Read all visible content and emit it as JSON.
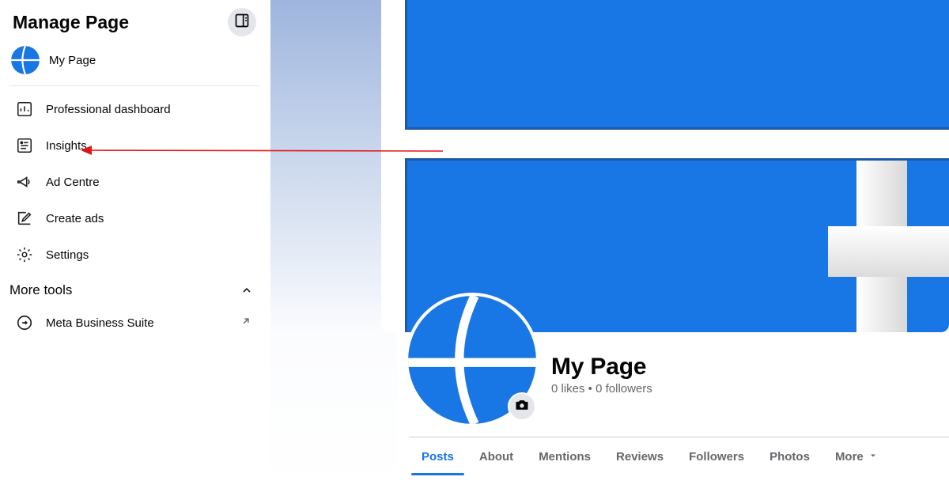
{
  "sidebar": {
    "title": "Manage Page",
    "page_name": "My Page",
    "items": [
      {
        "label": "Professional dashboard"
      },
      {
        "label": "Insights"
      },
      {
        "label": "Ad Centre"
      },
      {
        "label": "Create ads"
      },
      {
        "label": "Settings"
      }
    ],
    "more_tools_label": "More tools",
    "mbs_label": "Meta Business Suite"
  },
  "main": {
    "page_title": "My Page",
    "stats": "0 likes • 0 followers",
    "tabs": [
      {
        "label": "Posts"
      },
      {
        "label": "About"
      },
      {
        "label": "Mentions"
      },
      {
        "label": "Reviews"
      },
      {
        "label": "Followers"
      },
      {
        "label": "Photos"
      },
      {
        "label": "More"
      }
    ]
  }
}
